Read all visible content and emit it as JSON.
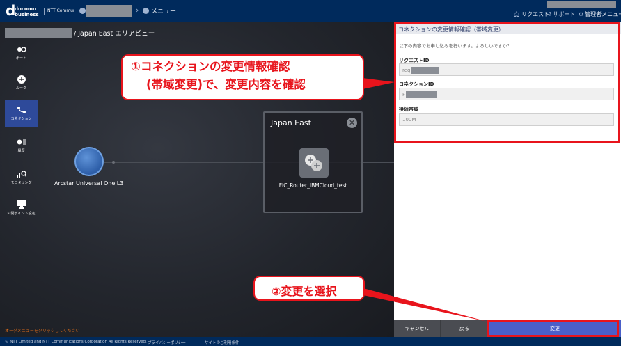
{
  "header": {
    "logo_mark": "d",
    "logo_line1": "docomo",
    "logo_line2": "business",
    "ntt_label": "NTT Communications",
    "breadcrumb_menu": "メニュー",
    "breadcrumb_sep": "›",
    "links": {
      "request": "リクエスト",
      "support": "サポート",
      "admin": "管理者メニュー"
    }
  },
  "area": {
    "title_suffix": "/ Japan East エリアビュー"
  },
  "sidebar": {
    "items": [
      {
        "label": "ポート",
        "icon": "port-icon"
      },
      {
        "label": "ルータ",
        "icon": "router-icon"
      },
      {
        "label": "コネクション",
        "icon": "connection-icon",
        "active": true
      },
      {
        "label": "履歴",
        "icon": "history-icon"
      },
      {
        "label": "モニタリング",
        "icon": "monitoring-icon"
      },
      {
        "label": "公開ポイント設定",
        "icon": "publish-point-icon"
      }
    ]
  },
  "diagram": {
    "node_label": "Arcstar Universal One L3",
    "area_name": "Japan East",
    "close_symbol": "✕",
    "router_label": "FIC_Router_IBMCloud_test"
  },
  "order_hint": "オーダメニューをクリックしてください",
  "panel": {
    "title": "コネクションの変更情報確認（帯域変更）",
    "message": "以下の内容でお申し込みを行います。よろしいですか？",
    "request_id_label": "リクエストID",
    "request_id_prefix": "req",
    "connection_id_label": "コネクションID",
    "connection_id_prefix": "F",
    "bandwidth_label": "接続帯域",
    "bandwidth_value": "100M"
  },
  "buttons": {
    "cancel": "キャンセル",
    "back": "戻る",
    "change": "変更"
  },
  "footer": {
    "copyright": "© NTT Limited and NTT Communications Corporation All Rights Reserved.",
    "privacy": "プライバシーポリシー",
    "terms": "サイトのご利用条件"
  },
  "callouts": {
    "c1_line1": "①コネクションの変更情報確認",
    "c1_line2": "(帯域変更)で、変更内容を確認",
    "c2": "②変更を選択"
  },
  "colors": {
    "accent_red": "#e8141c",
    "header_navy": "#002a5c",
    "primary_button": "#4a5fc9",
    "active_sidebar": "#2e4a9a"
  }
}
